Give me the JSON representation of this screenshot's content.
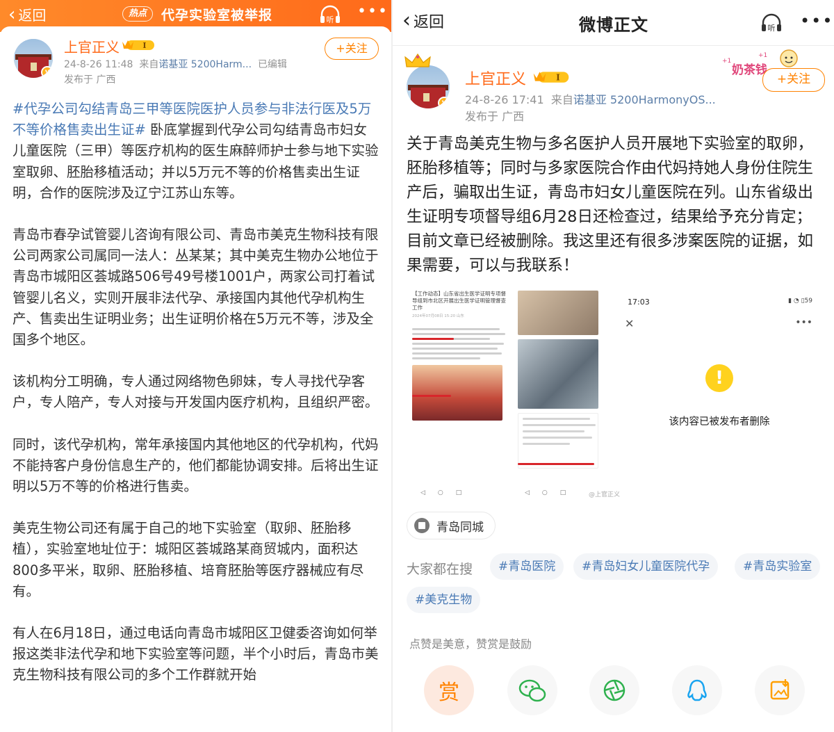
{
  "left": {
    "topbar": {
      "back_label": "返回",
      "hot_chip": "热点",
      "hot_title": "代孕实验室被举报",
      "listen_label": "听"
    },
    "post": {
      "username": "上官正义",
      "level_badge": "I",
      "time": "24-8-26 11:48",
      "source_prefix": "来自",
      "source": "诺基亚 5200Harm...",
      "edited": "已编辑",
      "location": "发布于 广西",
      "follow_label": "+关注",
      "paragraphs": [
        {
          "tag": "#代孕公司勾结青岛三甲等医院医护人员参与非法行医及5万不等价格售卖出生证#",
          "text": " 卧底掌握到代孕公司勾结青岛市妇女儿童医院（三甲）等医疗机构的医生麻醉师护士参与地下实验室取卵、胚胎移植活动；并以5万元不等的价格售卖出生证明，合作的医院涉及辽宁江苏山东等。"
        },
        {
          "tag": "",
          "text": "青岛市春孕试管婴儿咨询有限公司、青岛市美克生物科技有限公司两家公司属同一法人：丛某某；其中美克生物办公地位于青岛市城阳区荟城路506号49号楼1001户，两家公司打着试管婴儿名义，实则开展非法代孕、承接国内其他代孕机构生产、售卖出生证明业务；出生证明价格在5万元不等，涉及全国多个地区。"
        },
        {
          "tag": "",
          "text": "该机构分工明确，专人通过网络物色卵妹，专人寻找代孕客户，专人陪产，专人对接与开发国内医疗机构，且组织严密。"
        },
        {
          "tag": "",
          "text": "同时，该代孕机构，常年承接国内其他地区的代孕机构，代妈不能持客户身份信息生产的，他们都能协调安排。后将出生证明以5万不等的价格进行售卖。"
        },
        {
          "tag": "",
          "text": "美克生物公司还有属于自己的地下实验室（取卵、胚胎移植），实验室地址位于：城阳区荟城路某商贸城内，面积达800多平米，取卵、胚胎移植、培育胚胎等医疗器械应有尽有。"
        },
        {
          "tag": "",
          "text": "有人在6月18日，通过电话向青岛市城阳区卫健委咨询如何举报这类非法代孕和地下实验室等问题，半个小时后，青岛市美克生物科技有限公司的多个工作群就开始"
        }
      ]
    }
  },
  "right": {
    "topbar": {
      "back_label": "返回",
      "title": "微博正文",
      "listen_label": "听"
    },
    "sticker_text": "奶茶钱",
    "post": {
      "username": "上官正义",
      "level_badge": "I",
      "time": "24-8-26 17:41",
      "source_prefix": "来自",
      "source": "诺基亚 5200HarmonyOS...",
      "location": "发布于 广西",
      "follow_label": "+关注",
      "body": "关于青岛美克生物与多名医护人员开展地下实验室的取卵，胚胎移植等；同时与多家医院合作由代妈持她人身份住院生产后，骗取出生证，青岛市妇女儿童医院在列。山东省级出生证明专项督导组6月28日还检查过，结果给予充分肯定；目前文章已经被删除。我这里还有很多涉案医院的证据，如果需要，可以与我联系！"
    },
    "screenshot": {
      "doc_headline": "【工作动态】山东省出生医学证明专项督导组到市北区开展出生医学证明管理督查工作",
      "doc_meta": "2024年07月08日 15:20 山东",
      "phone_time": "17:03",
      "phone_battery": "59",
      "deleted_text": "该内容已被发布者删除",
      "watermark": "@上官正义"
    },
    "location_chip": "青岛同城",
    "search": {
      "label": "大家都在搜",
      "tags": [
        "#青岛医院",
        "#青岛妇女儿童医院代孕",
        "#青岛实验室",
        "#美克生物"
      ]
    },
    "reward_note": "点赞是美意，赞赏是鼓励",
    "share": {
      "reward_label": "赏"
    },
    "colors": {
      "accent_orange": "#ff8200",
      "username_orange": "#ff6a1a",
      "link_blue": "#4a7ab5"
    }
  }
}
